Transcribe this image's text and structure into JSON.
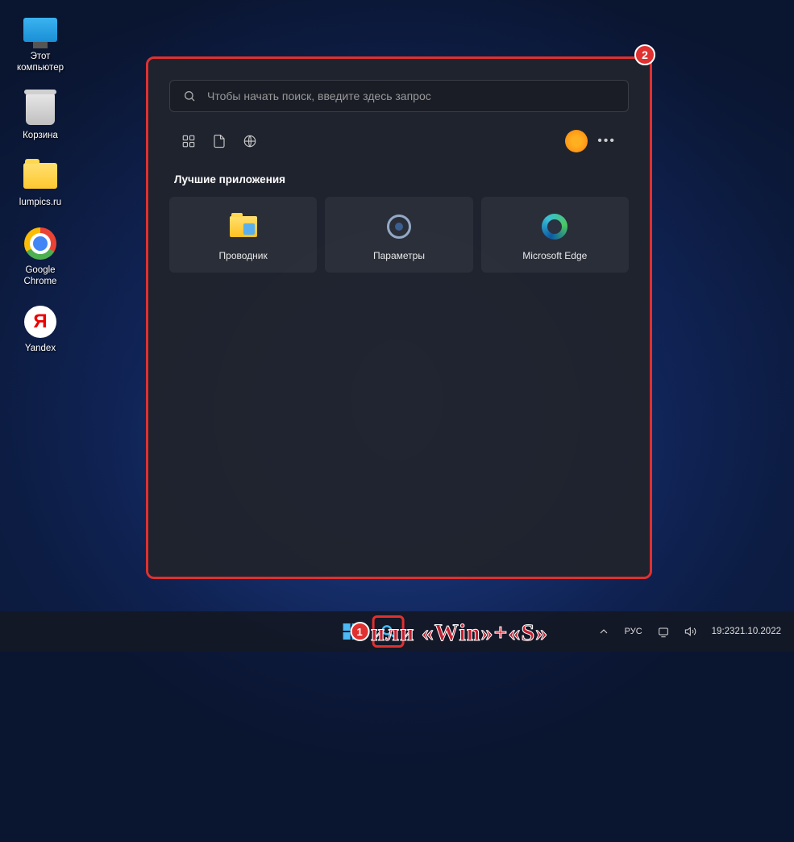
{
  "desktop_icons": [
    {
      "label": "Этот компьютер"
    },
    {
      "label": "Корзина"
    },
    {
      "label": "lumpics.ru"
    },
    {
      "label": "Google Chrome"
    },
    {
      "label": "Yandex"
    }
  ],
  "search": {
    "placeholder": "Чтобы начать поиск, введите здесь запрос"
  },
  "section_title": "Лучшие приложения",
  "apps": [
    {
      "label": "Проводник"
    },
    {
      "label": "Параметры"
    },
    {
      "label": "Microsoft Edge"
    }
  ],
  "tray": {
    "lang": "РУС",
    "time": "19:23",
    "date": "21.10.2022"
  },
  "annotations": {
    "badge1": "1",
    "badge2": "2",
    "hint": "или «Win»+«S»"
  }
}
